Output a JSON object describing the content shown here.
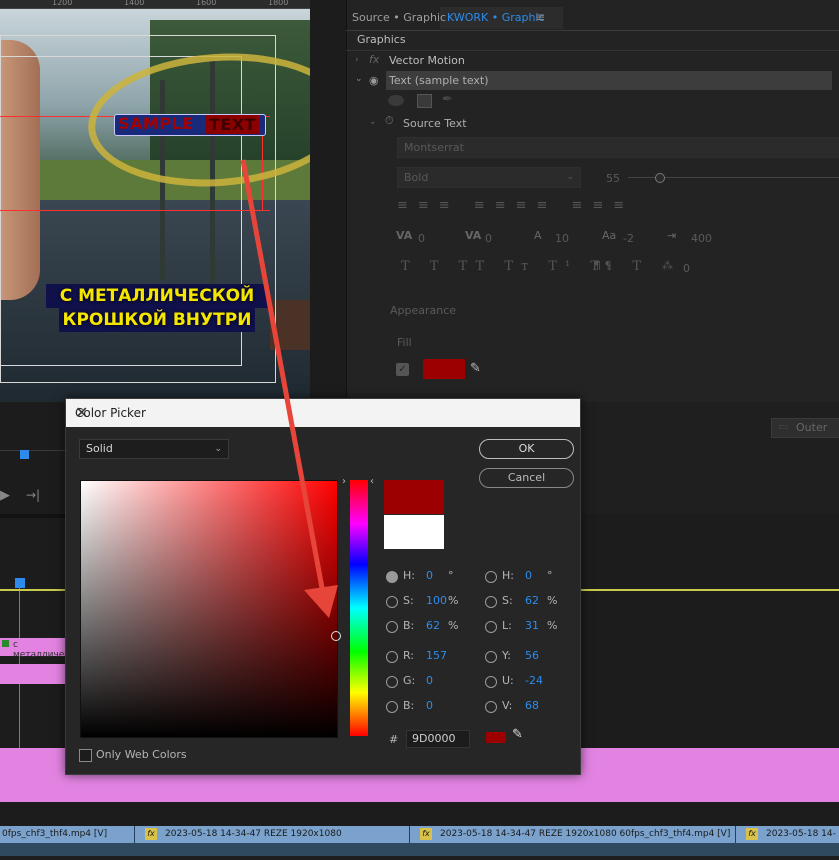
{
  "monitor": {
    "ruler": [
      "1200",
      "1400",
      "1600",
      "1800"
    ],
    "sample_text_a": "SAMPLE",
    "sample_text_b": "TEXT",
    "caption_line1": "С МЕТАЛЛИЧЕСКОЙ",
    "caption_line2": "КРОШКОЙ ВНУТРИ"
  },
  "panel": {
    "tabs": [
      {
        "label": "Source • Graphic"
      },
      {
        "label": "KWORK • Graphic"
      }
    ],
    "menu_icon": "≡",
    "section": "Graphics",
    "vector_motion": "Vector Motion",
    "text_layer": "Text (sample text)",
    "source_text": "Source Text",
    "font": "Montserrat",
    "style": "Bold",
    "size": "55",
    "tracking": [
      "0",
      "0",
      "10",
      "-2",
      "400",
      "0"
    ],
    "appearance": "Appearance",
    "fill": "Fill",
    "fill_color": "#9d0000",
    "outer": "Outer"
  },
  "dialog": {
    "title": "Color Picker",
    "close": "✕",
    "mode": "Solid",
    "ok": "OK",
    "cancel": "Cancel",
    "new_color": "#9d0000",
    "old_color": "#ffffff",
    "left_fields": [
      {
        "label": "H:",
        "value": "0",
        "unit": "°"
      },
      {
        "label": "S:",
        "value": "100",
        "unit": "%"
      },
      {
        "label": "B:",
        "value": "62",
        "unit": "%"
      },
      {
        "label": "R:",
        "value": "157",
        "unit": ""
      },
      {
        "label": "G:",
        "value": "0",
        "unit": ""
      },
      {
        "label": "B:",
        "value": "0",
        "unit": ""
      }
    ],
    "right_fields": [
      {
        "label": "H:",
        "value": "0",
        "unit": "°"
      },
      {
        "label": "S:",
        "value": "62",
        "unit": "%"
      },
      {
        "label": "L:",
        "value": "31",
        "unit": "%"
      },
      {
        "label": "Y:",
        "value": "56",
        "unit": ""
      },
      {
        "label": "U:",
        "value": "-24",
        "unit": ""
      },
      {
        "label": "V:",
        "value": "68",
        "unit": ""
      }
    ],
    "hash": "#",
    "hex": "9D0000",
    "only_web": "Only Web Colors"
  },
  "timeline": {
    "clip_small": "с металлическ",
    "clips": [
      "0fps_chf3_thf4.mp4 [V]",
      "2023-05-18 14-34-47 REZE 1920x1080 60fps_chf3_thf4.mp",
      "2023-05-18 14-34-47 REZE 1920x1080 60fps_chf3_thf4.mp4 [V]",
      "2023-05-18 14-3"
    ],
    "fx": "fx"
  }
}
